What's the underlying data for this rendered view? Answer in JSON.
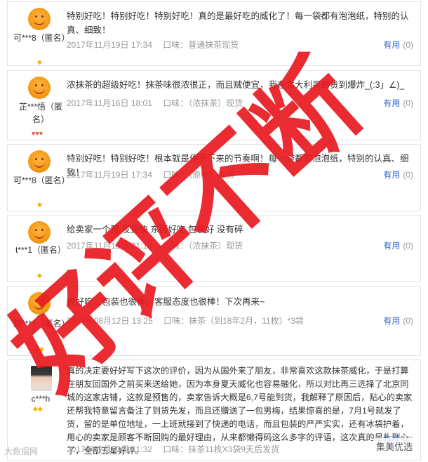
{
  "reviews": [
    {
      "user": "可***8（匿名）",
      "content": "特别好吃！特别好吃！特别好吃！真的是最好吃的威化了！每一袋都有泡泡纸，特别的认真、细致！",
      "date": "2017年11月19日 17:34",
      "flavor": "口味：普通抹茶现货",
      "useful_label": "有用",
      "useful_count": "(0)",
      "badge": "◆"
    },
    {
      "user": "芷***悟（匿名）",
      "content": "浓抹茶的超级好吃！抹茶味很浓很正，而且贼便宜，我在意大利买的贵到爆炸_(:3」∠)_",
      "date": "2017年11月16日 18:01",
      "flavor": "口味：（浓抹茶）现货",
      "useful_label": "有用",
      "useful_count": "(0)",
      "badge": "♥♥♥"
    },
    {
      "user": "可***8（匿名）",
      "content": "特别好吃！特别好吃！根本就是停不下来的节奏啊！每一袋都有泡泡纸，特别的认真、细致！",
      "date": "2017年11月19日 17:34",
      "flavor": "口味：（原味）现货",
      "useful_label": "有用",
      "useful_count": "(0)",
      "badge": "◆"
    },
    {
      "user": "t***1（匿名）",
      "content": "给卖家一个赞 发货快 东西好吃 包装好 没有碎",
      "date": "2017年11月15日 21:10",
      "flavor": "口味：（浓抹茶）现货",
      "useful_label": "有用",
      "useful_count": "(0)",
      "badge": "◆"
    },
    {
      "user": "楚***1（匿名）",
      "content": "很好吃，包装也很棒，客服态度也很棒！下次再来~",
      "date": "2017年08月12日 13:25",
      "flavor": "口味：抹茶（到18年2月，11枚）*3袋",
      "useful_label": "有用",
      "useful_count": "(0)",
      "badge": "◆◆"
    },
    {
      "user": "c***h",
      "content": "真的决定要好好写下这次的评价，因为从国外来了朋友，非常喜欢这款抹茶威化，于是打算在朋友回国外之前买来送给她，因为本身夏天威化也容易融化，所以对比再三选择了北京同城的这家店铺，这款是预售的，卖家告诉大概是6,7号能到货，我解释了原因后，贴心的卖家还帮我特意留言备注了到货先发，而且还赠送了一包男梅，结果惊喜的是，7月1号就发了货，留的是单位地址，一上班就接到了快递的电话，而且包装的严严实实，还有冰袋护着，用心的卖家是顾客不断回购的最好理由，从来都懒得码这么多字的评语，这次真的是扎到心了，全部五星好评。",
      "date": "2017年07月03日 11:32",
      "flavor": "口味：抹茶11枚X3袋9天后发货",
      "useful_label": "有用",
      "useful_count": "(0)",
      "badge": "◆◆"
    }
  ],
  "watermark_text": "好评不断",
  "footer": {
    "logo": "大数据网",
    "wechat": "集美优选"
  },
  "colors": {
    "watermark": "#e8191f",
    "link": "#3366cc"
  }
}
